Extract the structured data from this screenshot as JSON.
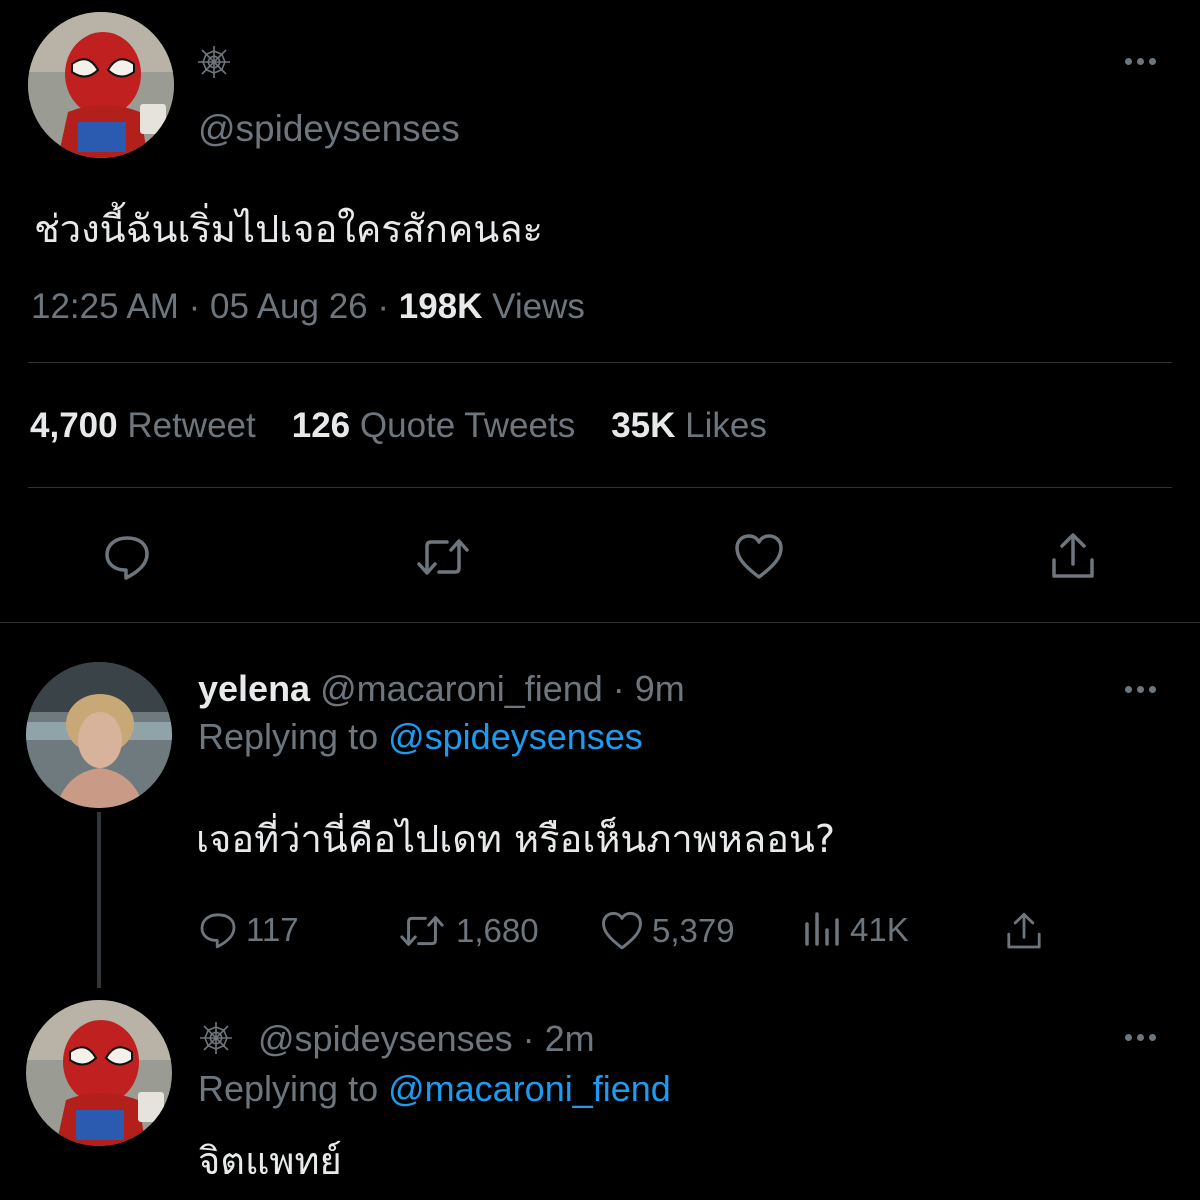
{
  "main_tweet": {
    "handle": "@spideysenses",
    "text": "ช่วงนี้ฉันเริ่มไปเจอใครสักคนละ",
    "meta_time": "12:25 AM · 05 Aug 26 · ",
    "views_count": "198K",
    "views_label": " Views",
    "stats": {
      "retweets_count": "4,700",
      "retweets_label": "Retweet",
      "quotes_count": "126",
      "quotes_label": "Quote Tweets",
      "likes_count": "35K",
      "likes_label": "Likes"
    },
    "actions": [
      "reply-icon",
      "retweet-icon",
      "like-icon",
      "share-icon"
    ]
  },
  "reply_1": {
    "display_name": "yelena",
    "handle_time": "@macaroni_fiend · 9m",
    "replying_prefix": "Replying to ",
    "replying_to": "@spideysenses",
    "text": "เจอที่ว่านี่คือไปเดท หรือเห็นภาพหลอน?",
    "metrics": {
      "replies": "117",
      "retweets": "1,680",
      "likes": "5,379",
      "views": "41K"
    }
  },
  "reply_2": {
    "handle_time": "@spideysenses · 2m",
    "replying_prefix": "Replying to ",
    "replying_to": "@macaroni_fiend",
    "text": "จิตแพทย์"
  },
  "colors": {
    "background": "#000000",
    "text": "#e7e9ea",
    "secondary": "#6e767d",
    "link": "#1d9bf0",
    "divider": "#2f3336"
  }
}
